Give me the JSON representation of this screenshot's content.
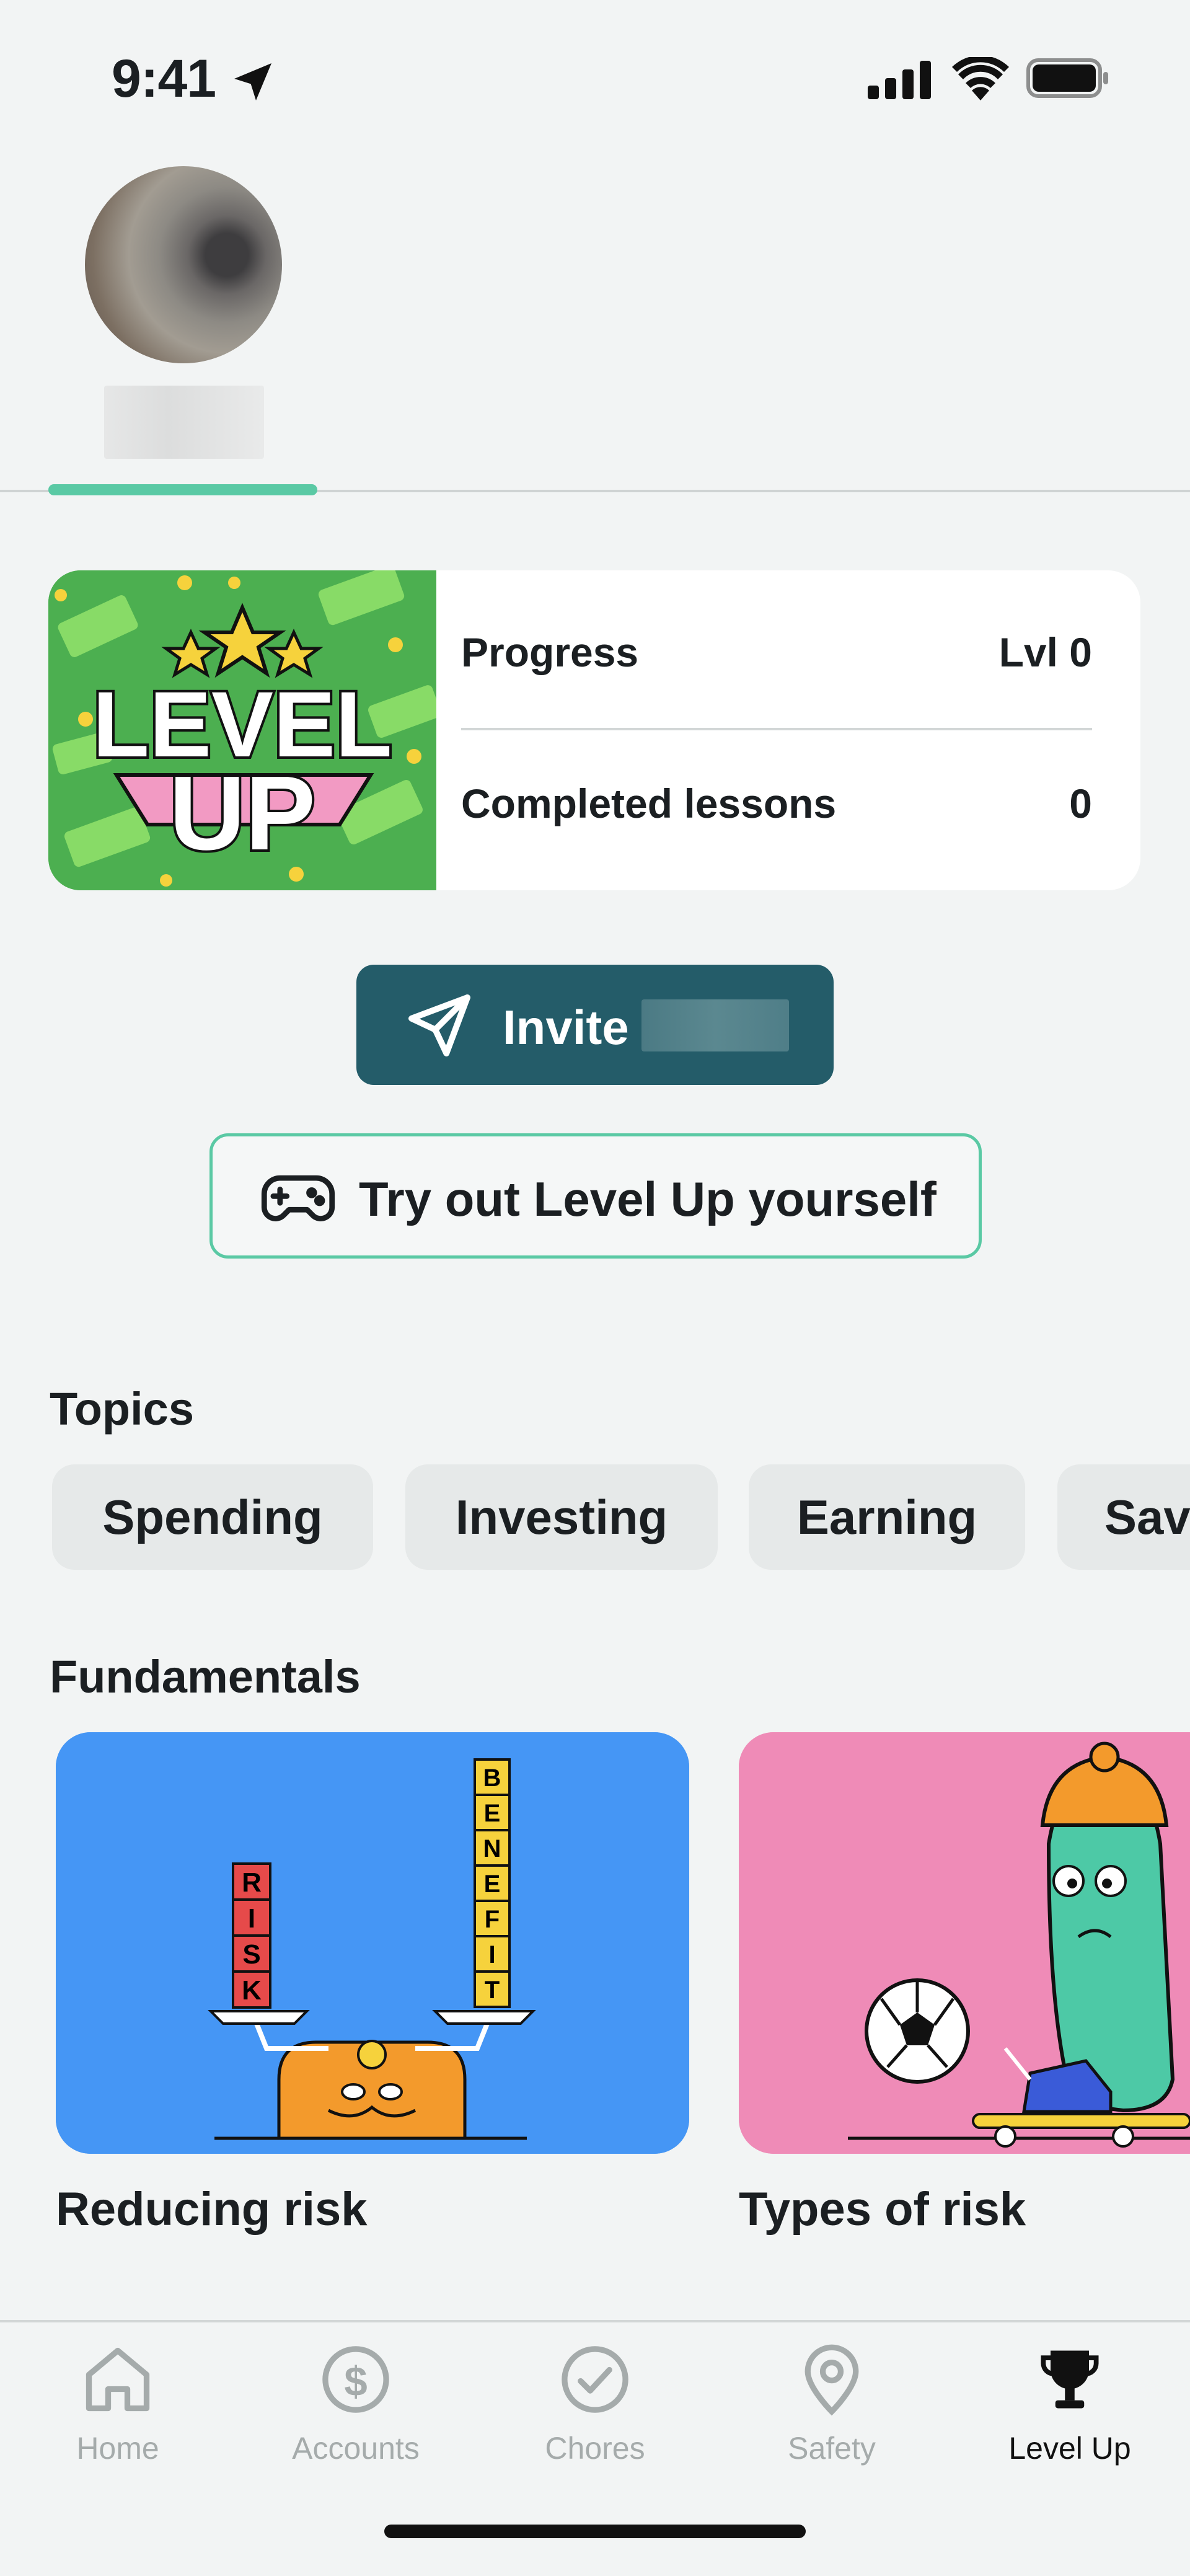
{
  "status_bar": {
    "time": "9:41"
  },
  "progress_card": {
    "rows": [
      {
        "label": "Progress",
        "value": "Lvl 0"
      },
      {
        "label": "Completed lessons",
        "value": "0"
      }
    ],
    "badge_art_text": [
      "LEVEL",
      "UP"
    ]
  },
  "invite_button": {
    "label": "Invite"
  },
  "try_button": {
    "label": "Try out Level Up yourself"
  },
  "topics": {
    "title": "Topics",
    "chips": [
      "Spending",
      "Investing",
      "Earning",
      "Sav"
    ]
  },
  "fundamentals": {
    "title": "Fundamentals",
    "lessons": [
      {
        "title": "Reducing risk",
        "background": "#4596f5",
        "art_words": [
          "RISK",
          "BENEFIT"
        ]
      },
      {
        "title": "Types of risk",
        "background": "#ef8bb7"
      }
    ]
  },
  "bottom_nav": {
    "items": [
      {
        "label": "Home",
        "icon": "home-icon",
        "active": false
      },
      {
        "label": "Accounts",
        "icon": "dollar-coin-icon",
        "active": false
      },
      {
        "label": "Chores",
        "icon": "check-circle-icon",
        "active": false
      },
      {
        "label": "Safety",
        "icon": "location-pin-icon",
        "active": false
      },
      {
        "label": "Level Up",
        "icon": "trophy-icon",
        "active": true
      }
    ]
  },
  "colors": {
    "accent_green": "#5ac9a4",
    "primary_button": "#245c69",
    "background": "#f2f4f4"
  }
}
